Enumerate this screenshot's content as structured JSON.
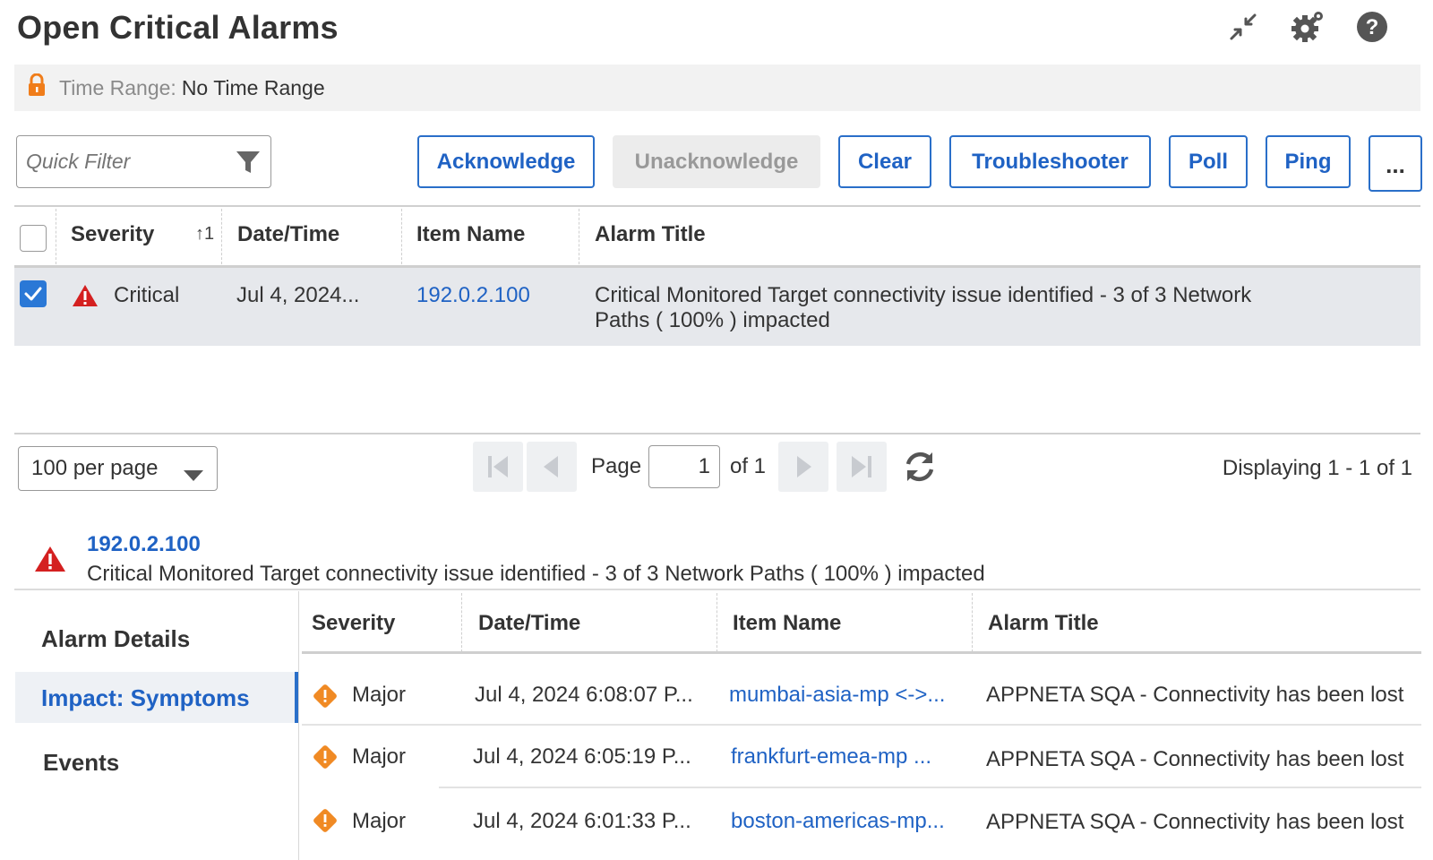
{
  "header": {
    "title": "Open Critical Alarms",
    "icons": [
      "collapse-icon",
      "settings-icon",
      "help-icon"
    ]
  },
  "time_range": {
    "label": "Time Range:",
    "value": "No Time Range"
  },
  "toolbar": {
    "quick_filter_placeholder": "Quick Filter",
    "acknowledge": "Acknowledge",
    "unacknowledge": "Unacknowledge",
    "clear": "Clear",
    "troubleshooter": "Troubleshooter",
    "poll": "Poll",
    "ping": "Ping",
    "more": "..."
  },
  "grid": {
    "columns": [
      "Severity",
      "Date/Time",
      "Item Name",
      "Alarm Title"
    ],
    "sort_indicator": "↑1",
    "rows": [
      {
        "checked": true,
        "severity": "Critical",
        "datetime": "Jul 4, 2024...",
        "item_name": "192.0.2.100",
        "title_line1": "Critical Monitored Target connectivity issue identified - 3 of 3 Network",
        "title_line2": "Paths ( 100% ) impacted"
      }
    ]
  },
  "pager": {
    "per_page": "100 per page",
    "page_label": "Page",
    "page_value": "1",
    "of_label": "of 1",
    "displaying": "Displaying 1 - 1 of 1"
  },
  "detail": {
    "item_name": "192.0.2.100",
    "title": "Critical Monitored Target connectivity issue identified - 3 of 3 Network Paths ( 100% ) impacted",
    "nav": {
      "alarm_details": "Alarm Details",
      "impact_symptoms": "Impact: Symptoms",
      "events": "Events"
    },
    "columns": [
      "Severity",
      "Date/Time",
      "Item Name",
      "Alarm Title"
    ],
    "rows": [
      {
        "severity": "Major",
        "datetime": "Jul 4, 2024 6:08:07 P...",
        "item_name": "mumbai-asia-mp <->...",
        "title": "APPNETA SQA - Connectivity has been lost"
      },
      {
        "severity": "Major",
        "datetime": "Jul 4, 2024 6:05:19 P...",
        "item_name": "frankfurt-emea-mp ...",
        "title": "APPNETA SQA - Connectivity has been lost"
      },
      {
        "severity": "Major",
        "datetime": "Jul 4, 2024 6:01:33 P...",
        "item_name": "boston-americas-mp...",
        "title": "APPNETA SQA - Connectivity has been lost"
      }
    ]
  },
  "colors": {
    "accent": "#1f62c4",
    "critical": "#d42020",
    "major": "#f08a24",
    "lock": "#f07d1a"
  }
}
